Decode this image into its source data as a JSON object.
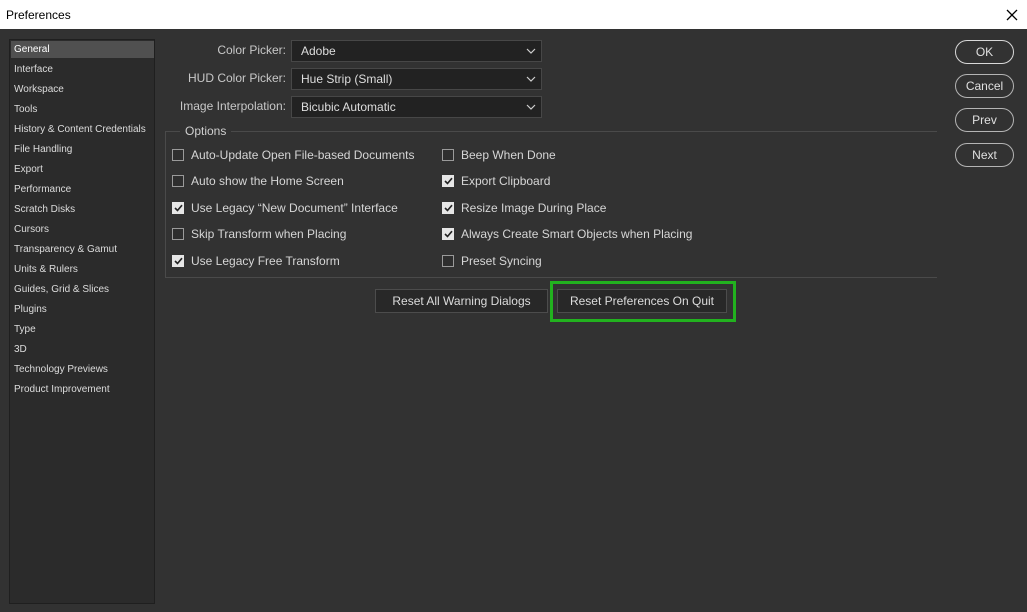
{
  "window": {
    "title": "Preferences"
  },
  "sidebar": {
    "items": [
      {
        "label": "General",
        "active": true
      },
      {
        "label": "Interface"
      },
      {
        "label": "Workspace"
      },
      {
        "label": "Tools"
      },
      {
        "label": "History & Content Credentials"
      },
      {
        "label": "File Handling"
      },
      {
        "label": "Export"
      },
      {
        "label": "Performance"
      },
      {
        "label": "Scratch Disks"
      },
      {
        "label": "Cursors"
      },
      {
        "label": "Transparency & Gamut"
      },
      {
        "label": "Units & Rulers"
      },
      {
        "label": "Guides, Grid & Slices"
      },
      {
        "label": "Plugins"
      },
      {
        "label": "Type"
      },
      {
        "label": "3D"
      },
      {
        "label": "Technology Previews"
      },
      {
        "label": "Product Improvement"
      }
    ]
  },
  "settings": {
    "color_picker": {
      "label": "Color Picker:",
      "value": "Adobe"
    },
    "hud_color_picker": {
      "label": "HUD Color Picker:",
      "value": "Hue Strip (Small)"
    },
    "image_interpolation": {
      "label": "Image Interpolation:",
      "value": "Bicubic Automatic"
    }
  },
  "options": {
    "title": "Options",
    "left": [
      {
        "label": "Auto-Update Open File-based Documents",
        "checked": false
      },
      {
        "label": "Auto show the Home Screen",
        "checked": false
      },
      {
        "label": "Use Legacy “New Document” Interface",
        "checked": true
      },
      {
        "label": "Skip Transform when Placing",
        "checked": false
      },
      {
        "label": "Use Legacy Free Transform",
        "checked": true
      }
    ],
    "right": [
      {
        "label": "Beep When Done",
        "checked": false
      },
      {
        "label": "Export Clipboard",
        "checked": true
      },
      {
        "label": "Resize Image During Place",
        "checked": true
      },
      {
        "label": "Always Create Smart Objects when Placing",
        "checked": true
      },
      {
        "label": "Preset Syncing",
        "checked": false
      }
    ]
  },
  "reset": {
    "warning_dialogs": "Reset All Warning Dialogs",
    "preferences_on_quit": "Reset Preferences On Quit"
  },
  "actions": {
    "ok": "OK",
    "cancel": "Cancel",
    "prev": "Prev",
    "next": "Next"
  },
  "colors": {
    "background": "#323232",
    "highlight": "#22b21f",
    "active_item": "#505050"
  },
  "icons": {
    "close": "close-icon",
    "dropdown": "chevron-down-icon",
    "check": "checkmark-icon"
  }
}
